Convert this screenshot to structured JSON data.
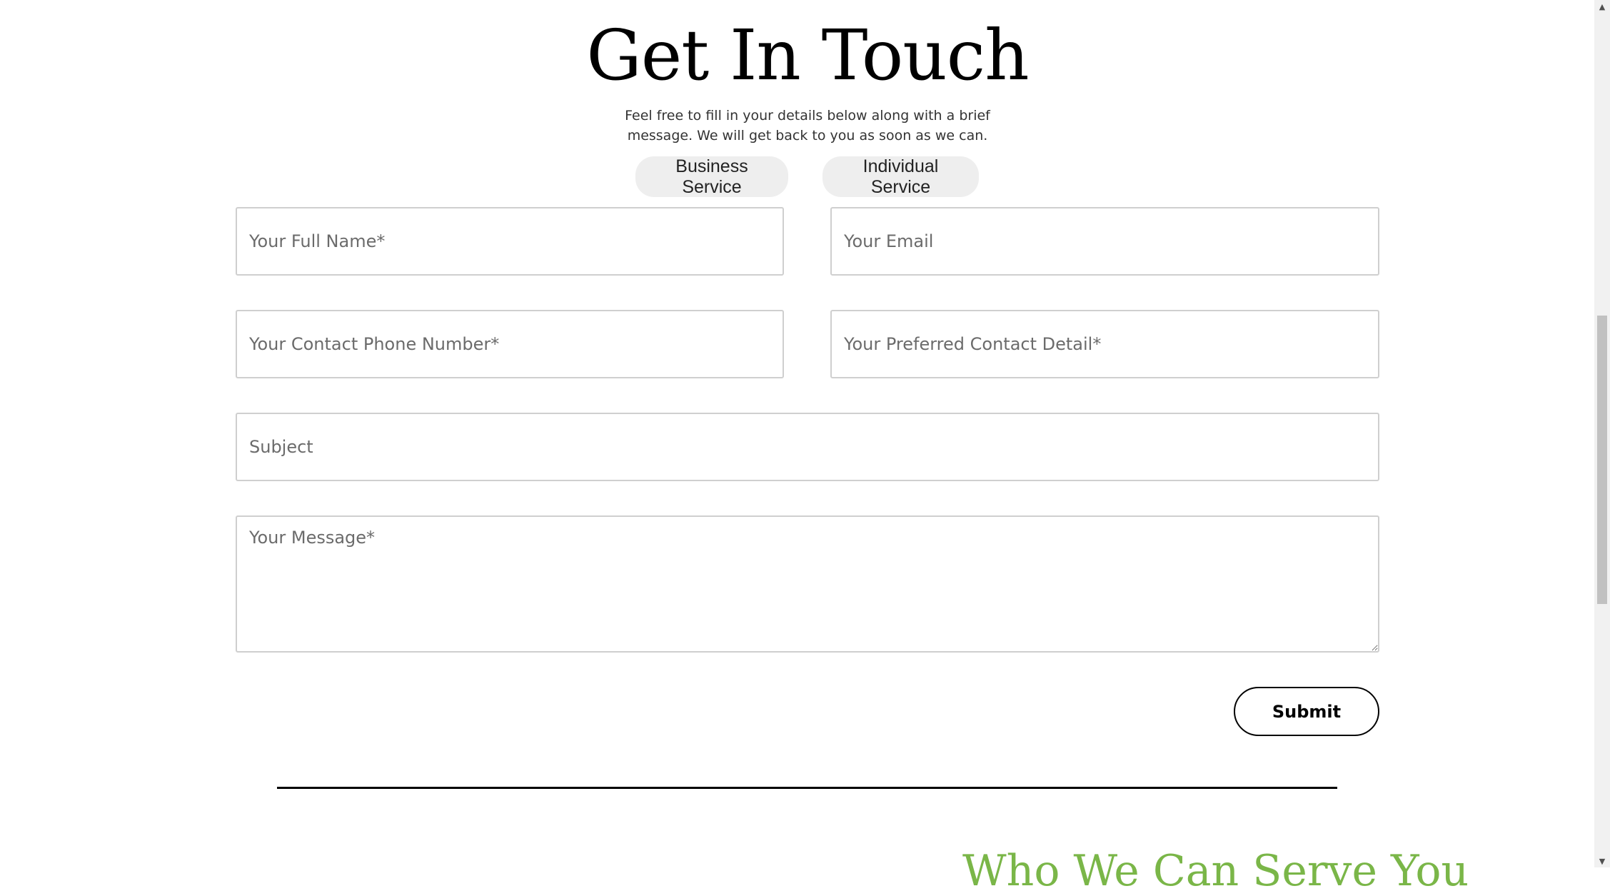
{
  "contact": {
    "title": "Get In Touch",
    "subtitle_line1": "Feel free to fill in your details below along with a brief",
    "subtitle_line2": "message. We will get back to you as soon as we can.",
    "service_tabs": {
      "business": "Business Service",
      "individual": "Individual Service"
    },
    "form": {
      "full_name_placeholder": "Your Full Name*",
      "email_placeholder": "Your Email",
      "phone_placeholder": "Your Contact Phone Number*",
      "preferred_contact_placeholder": "Your Preferred Contact Detail*",
      "subject_placeholder": "Subject",
      "message_placeholder": "Your Message*",
      "submit_label": "Submit"
    }
  },
  "next_section": {
    "partial_heading": "Who We Can Serve You"
  },
  "colors": {
    "accent_green": "#7ab648",
    "service_tab_bg": "#eeeeee",
    "field_border": "#cfcfcf"
  },
  "icons": {
    "scroll_up": "triangle-up-icon",
    "scroll_down": "triangle-down-icon"
  }
}
